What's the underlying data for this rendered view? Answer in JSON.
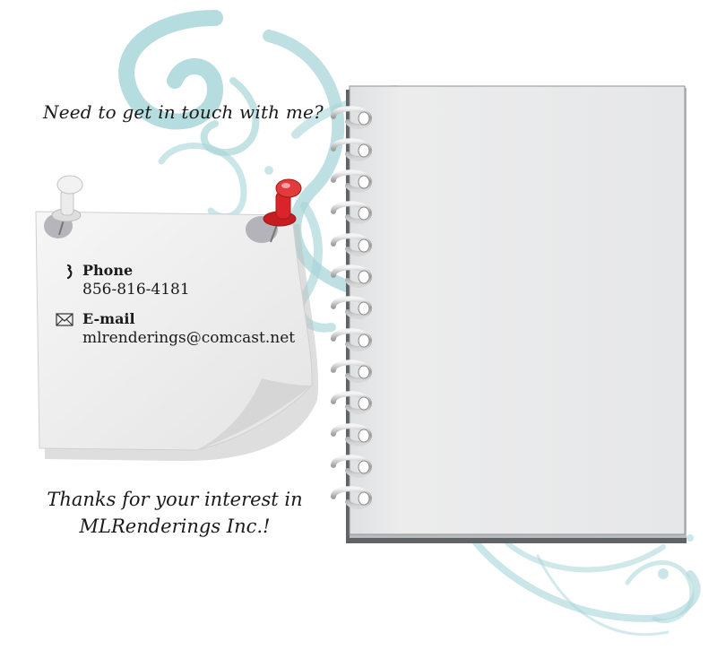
{
  "page": {
    "headline": "Need to get in touch with me?",
    "thanks_line1": "Thanks for your interest in",
    "thanks_line2": "MLRenderings Inc.!"
  },
  "contact": {
    "phone": {
      "icon": "phone-icon",
      "label": "Phone",
      "value": "856-816-4181"
    },
    "email": {
      "icon": "envelope-icon",
      "label": "E-mail",
      "value": "mlrenderings@comcast.net"
    }
  },
  "colors": {
    "swirl": "#a8d6d8",
    "notebook_page": "#e8e9ea",
    "pin_red": "#d9252a",
    "pin_white": "#e9e9e9"
  }
}
